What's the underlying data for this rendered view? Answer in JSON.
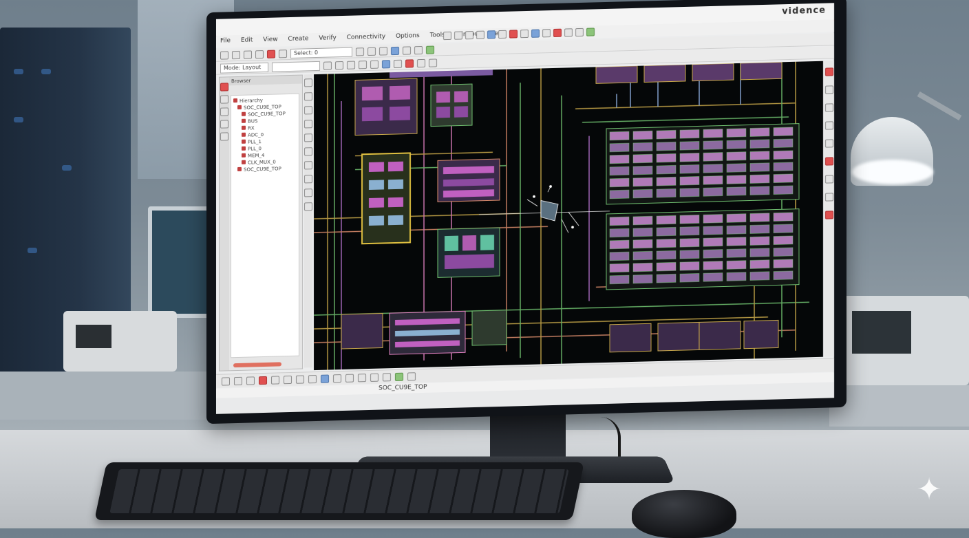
{
  "app": {
    "brand": "vidence",
    "menu": [
      "File",
      "Edit",
      "View",
      "Create",
      "Verify",
      "Connectivity",
      "Options",
      "Tools",
      "Window",
      "Help"
    ],
    "toolbar1_combo": "Select: 0",
    "toolbar2_combo": "Mode: Layout",
    "left_panel": {
      "header": "Browser",
      "tree": [
        "Hierarchy",
        "SOC_CU9E_TOP",
        "SOC_CU9E_TOP",
        "BUS",
        "RX",
        "ADC_0",
        "PLL_1",
        "PLL_0",
        "MEM_4",
        "CLK_MUX_0",
        "SOC_CU9E_TOP"
      ]
    },
    "status_text": "SOC_CU9E_TOP"
  },
  "icons": [
    "pointer-icon",
    "zoom-in-icon",
    "zoom-out-icon",
    "fit-icon",
    "ruler-icon",
    "layer-icon",
    "grid-icon",
    "undo-icon",
    "redo-icon",
    "save-icon",
    "open-icon"
  ],
  "colors": {
    "accent": "#c8202a",
    "canvas_bg": "#050708"
  }
}
